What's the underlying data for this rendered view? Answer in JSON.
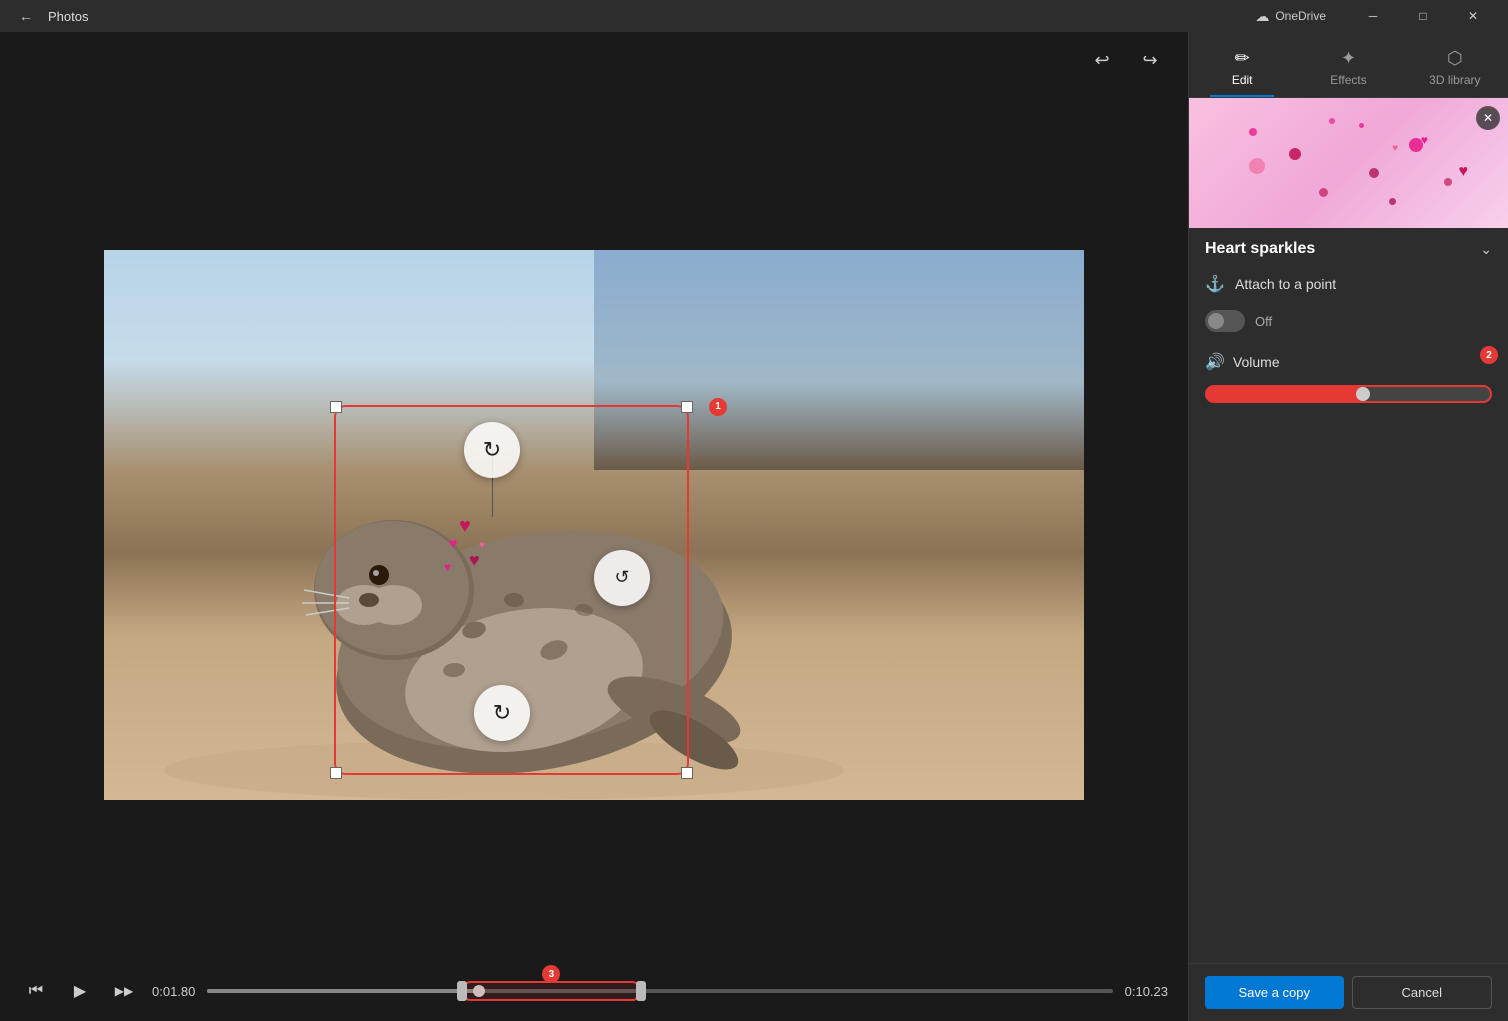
{
  "titlebar": {
    "title": "Photos",
    "back_icon": "←",
    "onedrive_label": "OneDrive",
    "win_minimize": "─",
    "win_restore": "□",
    "win_close": "✕"
  },
  "toolbar": {
    "undo_icon": "↩",
    "redo_icon": "↪"
  },
  "panel": {
    "tabs": [
      {
        "id": "edit",
        "label": "Edit",
        "icon": "✏️",
        "active": true
      },
      {
        "id": "effects",
        "label": "Effects",
        "icon": "✦"
      },
      {
        "id": "3dlibrary",
        "label": "3D library",
        "icon": "🎲"
      }
    ],
    "effect_title": "Heart sparkles",
    "attach_label": "Attach to a point",
    "toggle_label": "Off",
    "volume_label": "Volume",
    "save_label": "Save a copy",
    "cancel_label": "Cancel",
    "expand_icon": "⌄",
    "close_preview_icon": "✕",
    "anchor_icon": "⚓",
    "volume_icon": "🔊"
  },
  "timeline": {
    "current_time": "0:01.80",
    "end_time": "0:10.23",
    "badge1": "1",
    "badge2": "2",
    "badge3": "3"
  },
  "playback": {
    "skip_back": "⏮",
    "play": "▶",
    "skip_forward": "▶▶"
  }
}
